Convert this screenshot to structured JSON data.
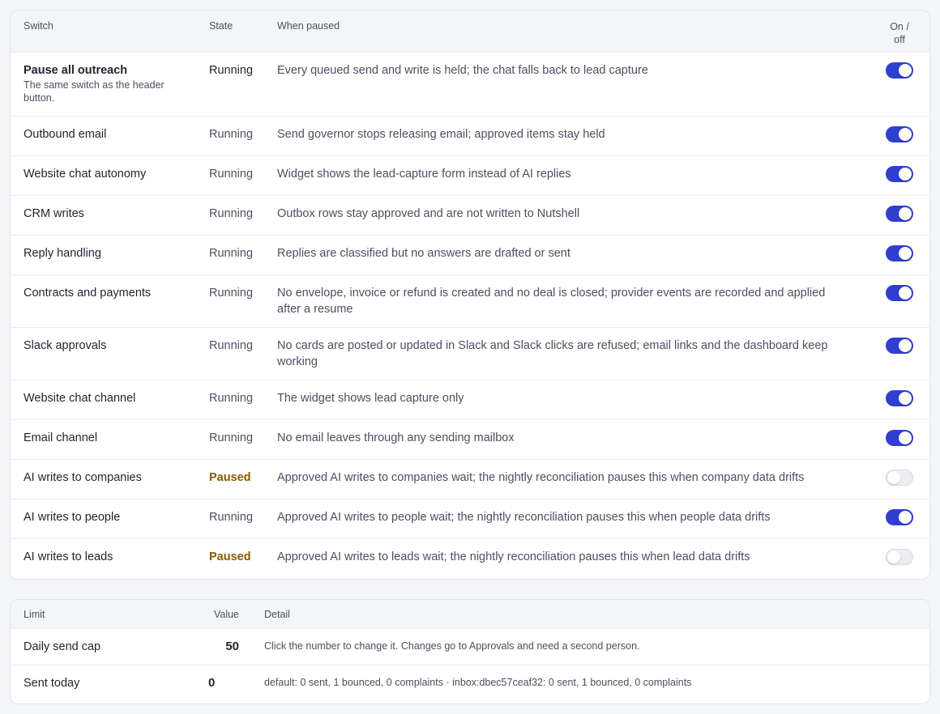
{
  "switches": {
    "headers": {
      "switch": "Switch",
      "state": "State",
      "when": "When paused",
      "onoff_line1": "On /",
      "onoff_line2": "off"
    },
    "rows": [
      {
        "name": "Pause all outreach",
        "sub": "The same switch as the header button.",
        "state": "Running",
        "when": "Every queued send and write is held; the chat falls back to lead capture",
        "on": true
      },
      {
        "name": "Outbound email",
        "state": "Running",
        "when": "Send governor stops releasing email; approved items stay held",
        "on": true
      },
      {
        "name": "Website chat autonomy",
        "state": "Running",
        "when": "Widget shows the lead-capture form instead of AI replies",
        "on": true
      },
      {
        "name": "CRM writes",
        "state": "Running",
        "when": "Outbox rows stay approved and are not written to Nutshell",
        "on": true
      },
      {
        "name": "Reply handling",
        "state": "Running",
        "when": "Replies are classified but no answers are drafted or sent",
        "on": true
      },
      {
        "name": "Contracts and payments",
        "state": "Running",
        "when": "No envelope, invoice or refund is created and no deal is closed; provider events are recorded and applied after a resume",
        "on": true
      },
      {
        "name": "Slack approvals",
        "state": "Running",
        "when": "No cards are posted or updated in Slack and Slack clicks are refused; email links and the dashboard keep working",
        "on": true
      },
      {
        "name": "Website chat channel",
        "state": "Running",
        "when": "The widget shows lead capture only",
        "on": true
      },
      {
        "name": "Email channel",
        "state": "Running",
        "when": "No email leaves through any sending mailbox",
        "on": true
      },
      {
        "name": "AI writes to companies",
        "state": "Paused",
        "when": "Approved AI writes to companies wait; the nightly reconciliation pauses this when company data drifts",
        "on": false
      },
      {
        "name": "AI writes to people",
        "state": "Running",
        "when": "Approved AI writes to people wait; the nightly reconciliation pauses this when people data drifts",
        "on": true
      },
      {
        "name": "AI writes to leads",
        "state": "Paused",
        "when": "Approved AI writes to leads wait; the nightly reconciliation pauses this when lead data drifts",
        "on": false
      }
    ]
  },
  "limits": {
    "headers": {
      "limit": "Limit",
      "value": "Value",
      "detail": "Detail"
    },
    "rows": [
      {
        "name": "Daily send cap",
        "value": "50",
        "detail": "Click the number to change it. Changes go to Approvals and need a second person."
      },
      {
        "name": "Sent today",
        "value": "0",
        "detail": "default: 0 sent, 1 bounced, 0 complaints · inbox:dbec57ceaf32: 0 sent, 1 bounced, 0 complaints"
      }
    ]
  },
  "colors": {
    "toggle_on": "#2f3fcf",
    "paused_text": "#8a5a00"
  }
}
